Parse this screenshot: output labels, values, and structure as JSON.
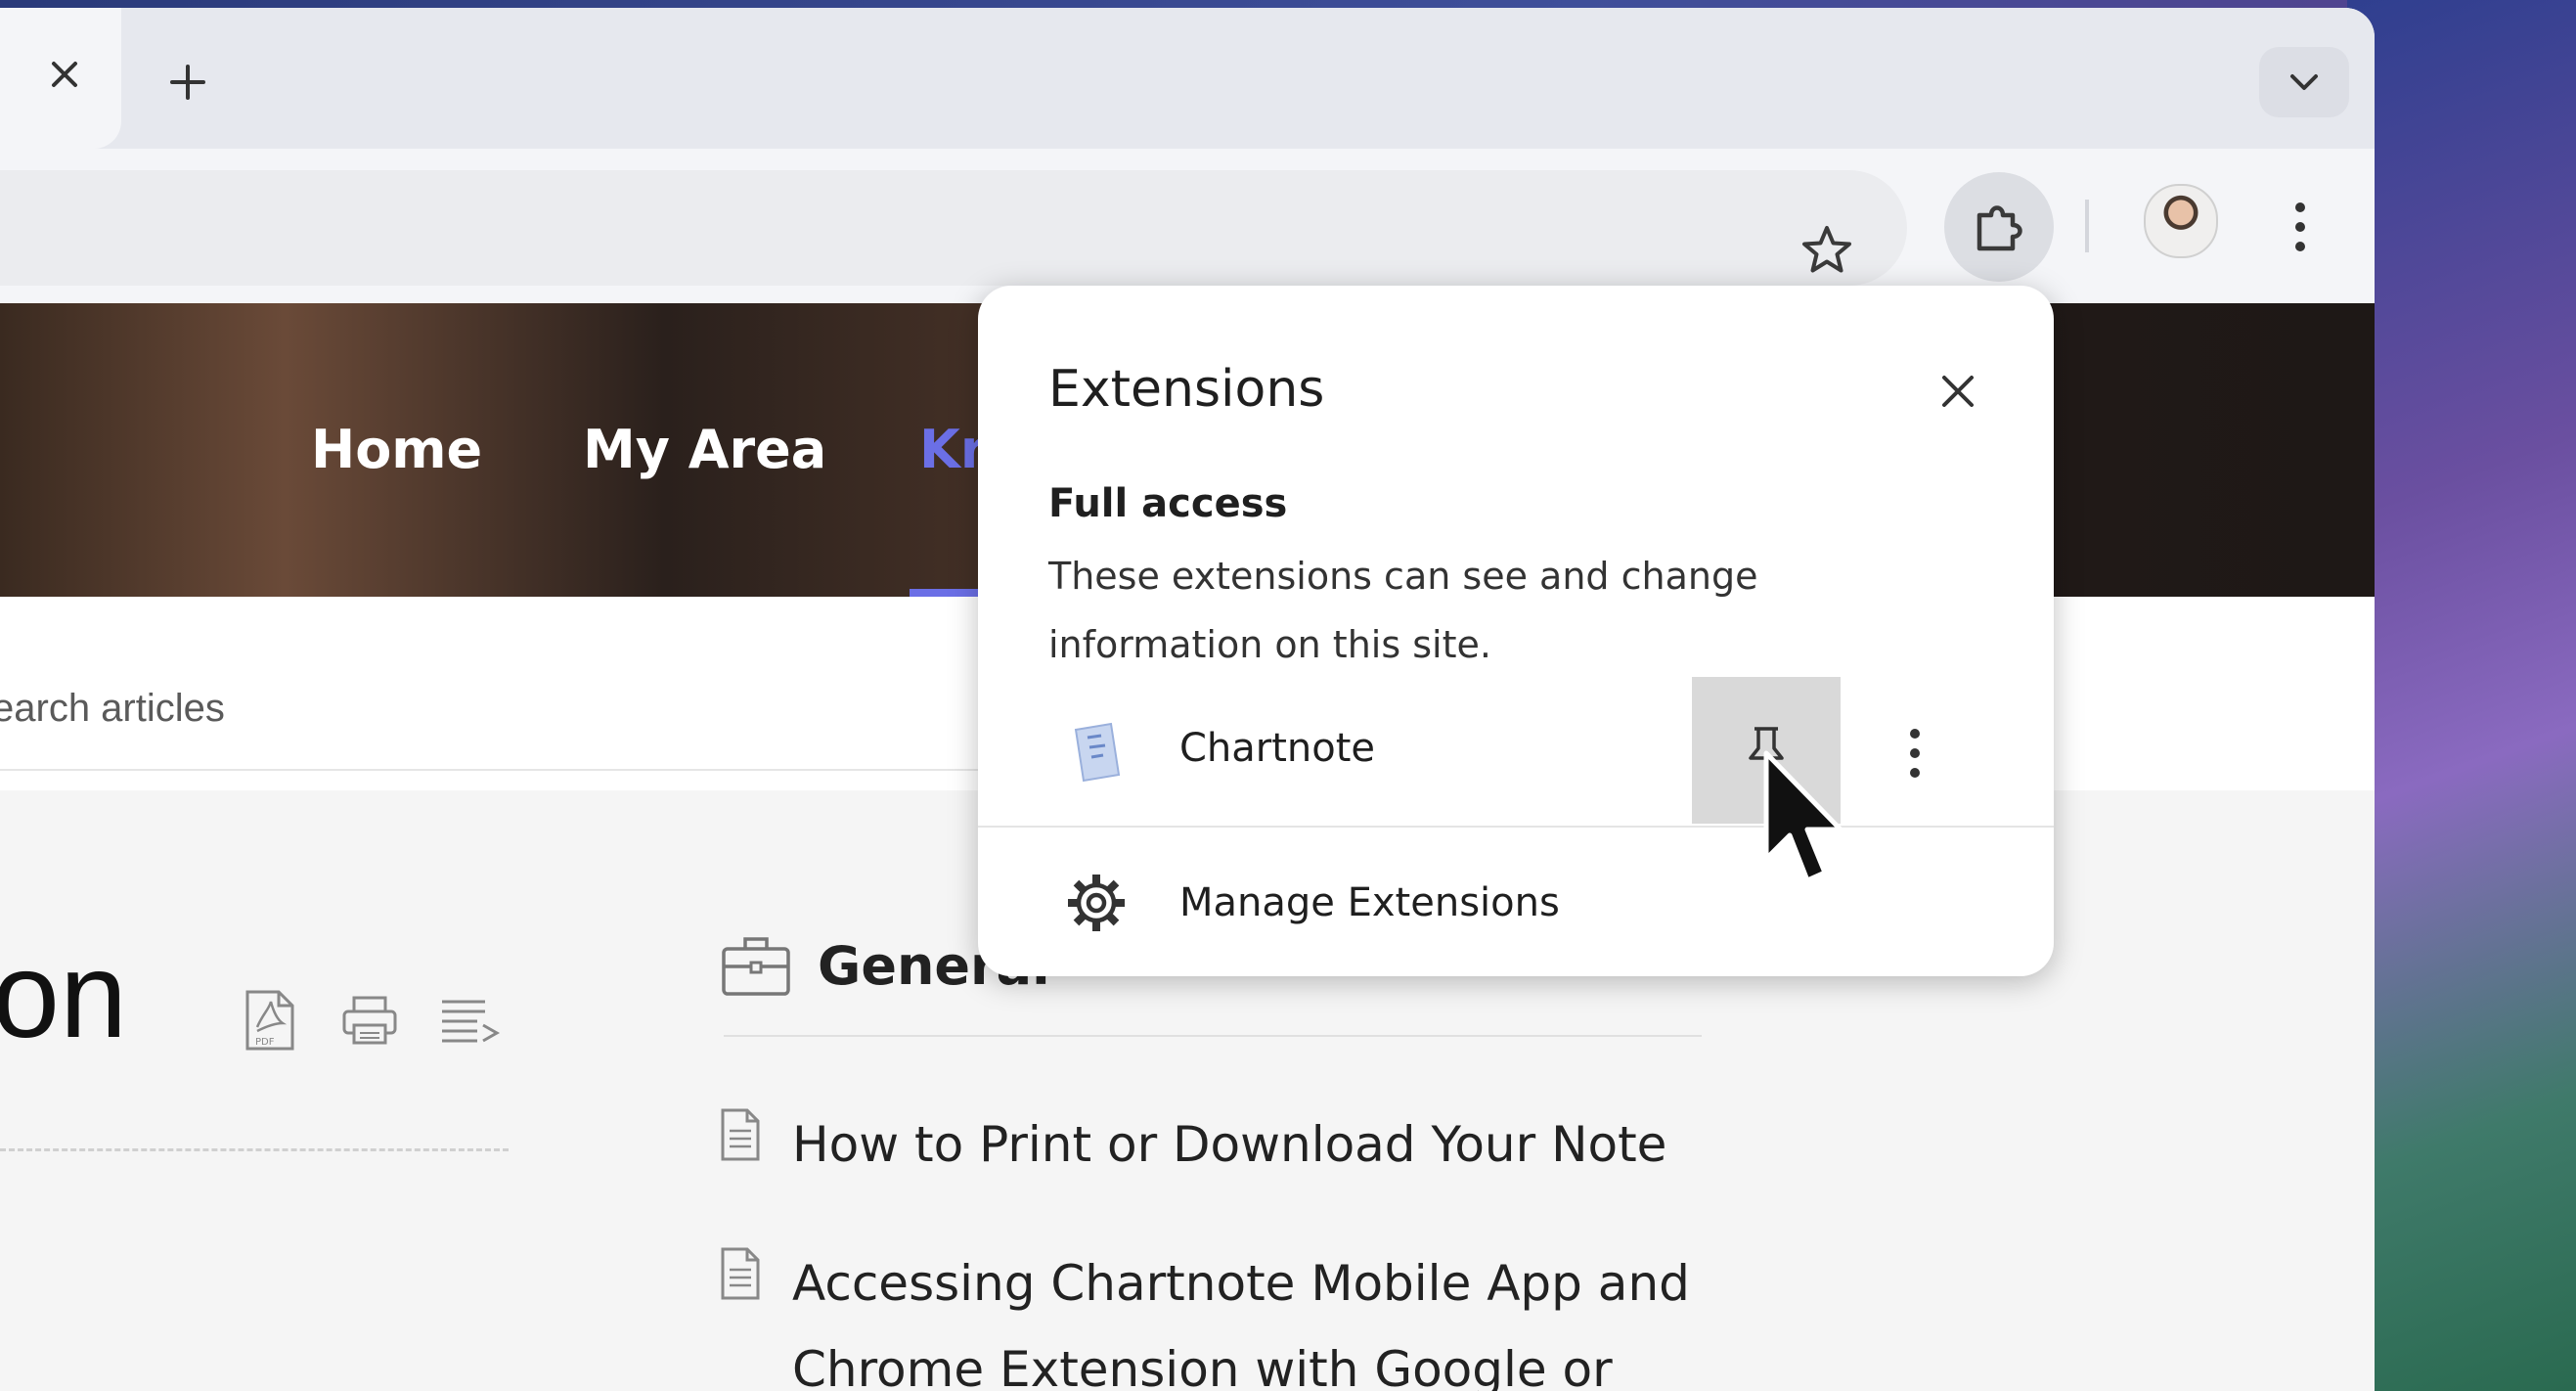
{
  "browser": {
    "tab_close_label": "×",
    "new_tab_label": "+"
  },
  "site": {
    "nav": [
      "Home",
      "My Area",
      "Kr"
    ],
    "search_placeholder": "earch articles",
    "page_title_fragment": "on",
    "category_title": "General",
    "articles": [
      {
        "lines": [
          "How to Print or Download Your Note"
        ]
      },
      {
        "lines": [
          "Accessing Chartnote Mobile App and",
          "Chrome Extension with Google or"
        ]
      }
    ],
    "accent_color": "#6b6fe6"
  },
  "extensions_popup": {
    "title": "Extensions",
    "section_title": "Full access",
    "section_description": "These extensions can see and change information on this site.",
    "extension_name": "Chartnote",
    "manage_label": "Manage Extensions"
  },
  "icons": [
    "close-icon",
    "plus-icon",
    "chevron-down-icon",
    "star-icon",
    "puzzle-icon",
    "avatar",
    "more-vert-icon",
    "pdf-icon",
    "print-icon",
    "text-align-icon",
    "briefcase-icon",
    "document-icon",
    "pin-icon",
    "gear-icon",
    "cursor-icon"
  ]
}
